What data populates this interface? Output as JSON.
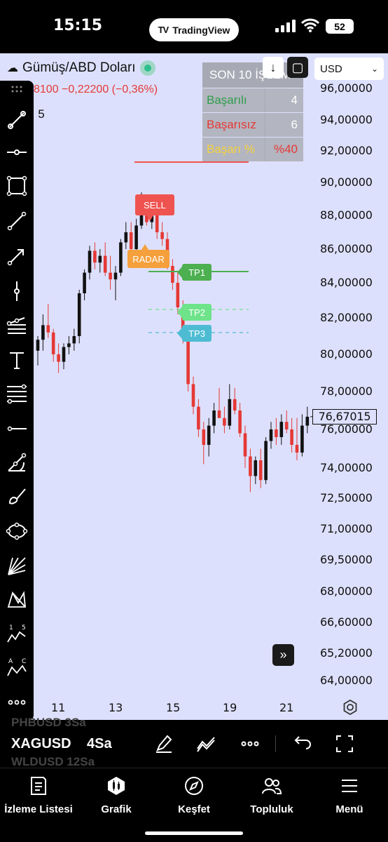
{
  "status": {
    "time": "15:15",
    "app_pill": "TradingView",
    "battery": "52"
  },
  "header": {
    "symbol_name": "Gümüş/ABD Doları",
    "quote_line": "8100  −0,22200 (−0,36%)",
    "interval": "5",
    "currency": "USD"
  },
  "stats": {
    "title": "SON 10 İŞLEM",
    "rows": [
      {
        "label": "Başarılı",
        "value": "4",
        "color": "#2e9e4a"
      },
      {
        "label": "Başarısız",
        "value": "6",
        "color": "#e53935"
      },
      {
        "label": "Başarı %",
        "value": "%40",
        "color": "#f5d23c",
        "value_color": "#e53935"
      }
    ]
  },
  "chart_data": {
    "type": "candlestick",
    "price_axis": [
      "96,00000",
      "94,00000",
      "92,00000",
      "90,00000",
      "88,00000",
      "86,00000",
      "84,00000",
      "82,00000",
      "80,00000",
      "78,00000",
      "76,00000",
      "74,00000",
      "72,50000",
      "71,00000",
      "69,50000",
      "68,00000",
      "66,60000",
      "65,20000",
      "64,00000"
    ],
    "time_axis": [
      "11",
      "13",
      "15",
      "19",
      "21"
    ],
    "last_price": "76,67015",
    "annotations": {
      "sell": "SELL",
      "radar": "RADAR",
      "tp1": "TP1",
      "tp2": "TP2",
      "tp3": "TP3"
    },
    "candles": [
      [
        80.2,
        81.0,
        79.4,
        80.8
      ],
      [
        80.8,
        82.2,
        80.2,
        81.6
      ],
      [
        81.6,
        82.8,
        80.9,
        81.2
      ],
      [
        81.2,
        81.4,
        79.6,
        80.0
      ],
      [
        80.0,
        80.6,
        79.0,
        79.6
      ],
      [
        79.6,
        80.6,
        79.2,
        80.4
      ],
      [
        80.4,
        81.0,
        80.0,
        80.6
      ],
      [
        80.6,
        81.4,
        80.2,
        81.0
      ],
      [
        81.0,
        83.6,
        80.6,
        83.4
      ],
      [
        83.4,
        84.8,
        83.0,
        84.6
      ],
      [
        84.6,
        86.2,
        84.2,
        85.9
      ],
      [
        85.9,
        86.4,
        84.8,
        85.2
      ],
      [
        85.2,
        86.0,
        84.6,
        85.6
      ],
      [
        85.6,
        86.4,
        84.4,
        84.6
      ],
      [
        84.6,
        85.6,
        83.6,
        84.2
      ],
      [
        84.2,
        85.0,
        83.0,
        84.6
      ],
      [
        84.6,
        86.6,
        84.4,
        86.4
      ],
      [
        86.4,
        87.6,
        86.0,
        87.0
      ],
      [
        87.0,
        87.6,
        85.6,
        86.0
      ],
      [
        86.0,
        87.8,
        85.8,
        87.4
      ],
      [
        87.4,
        89.4,
        87.2,
        88.6
      ],
      [
        88.6,
        89.0,
        87.4,
        87.6
      ],
      [
        87.6,
        88.8,
        87.2,
        88.4
      ],
      [
        88.4,
        88.6,
        86.6,
        87.0
      ],
      [
        87.0,
        87.6,
        86.2,
        86.6
      ],
      [
        86.6,
        87.0,
        84.8,
        85.0
      ],
      [
        85.0,
        85.4,
        83.6,
        84.0
      ],
      [
        84.0,
        84.6,
        82.2,
        82.6
      ],
      [
        82.6,
        83.0,
        80.6,
        81.0
      ],
      [
        81.0,
        81.4,
        78.0,
        78.4
      ],
      [
        78.4,
        78.8,
        76.8,
        77.2
      ],
      [
        77.2,
        77.6,
        75.6,
        76.0
      ],
      [
        76.0,
        76.4,
        74.2,
        75.2
      ],
      [
        75.2,
        76.6,
        74.6,
        76.2
      ],
      [
        76.2,
        77.4,
        75.8,
        77.0
      ],
      [
        77.0,
        78.2,
        76.6,
        76.6
      ],
      [
        76.6,
        77.2,
        75.8,
        76.2
      ],
      [
        76.2,
        78.4,
        76.0,
        77.6
      ],
      [
        77.6,
        78.2,
        76.8,
        77.0
      ],
      [
        77.0,
        77.4,
        75.6,
        75.8
      ],
      [
        75.8,
        76.2,
        74.0,
        74.6
      ],
      [
        74.6,
        75.0,
        72.8,
        73.6
      ],
      [
        73.6,
        74.6,
        73.2,
        74.4
      ],
      [
        74.4,
        75.0,
        73.0,
        73.4
      ],
      [
        73.4,
        75.6,
        73.2,
        75.4
      ],
      [
        75.4,
        76.4,
        75.0,
        76.0
      ],
      [
        76.0,
        76.6,
        75.2,
        75.6
      ],
      [
        75.6,
        76.8,
        75.2,
        76.4
      ],
      [
        76.4,
        77.0,
        75.8,
        76.0
      ],
      [
        76.0,
        76.6,
        74.8,
        75.2
      ],
      [
        75.2,
        76.6,
        74.4,
        74.8
      ],
      [
        74.8,
        76.8,
        74.6,
        76.2
      ],
      [
        76.2,
        77.2,
        75.8,
        76.67
      ]
    ]
  },
  "bottom": {
    "ghost_prev": "PHBUSD   3Sa",
    "symbol": "XAGUSD",
    "timeframe": "4Sa",
    "ghost_next": "WLDUSD   12Sa"
  },
  "tabs": [
    {
      "label": "İzleme Listesi"
    },
    {
      "label": "Grafik"
    },
    {
      "label": "Keşfet"
    },
    {
      "label": "Topluluk"
    },
    {
      "label": "Menü"
    }
  ],
  "colors": {
    "chart_bg": "#dde0fc",
    "up": "#111111",
    "down": "#e53935",
    "tp1": "#4caf50",
    "tp2": "#6ee38a",
    "tp3": "#4dbcd3",
    "sell": "#ef5350",
    "radar": "#f5a03c"
  }
}
